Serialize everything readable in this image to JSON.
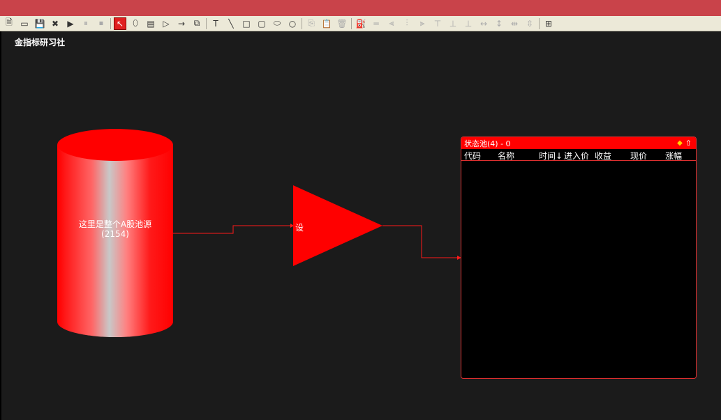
{
  "toolbar": {
    "buttons": [
      {
        "icon": "new-document-icon",
        "glyph": "🗎",
        "enabled": true
      },
      {
        "icon": "open-folder-icon",
        "glyph": "▭",
        "enabled": true
      },
      {
        "icon": "save-icon",
        "glyph": "💾",
        "enabled": true
      },
      {
        "icon": "close-x-icon",
        "glyph": "✖",
        "enabled": true
      },
      {
        "icon": "play-circle-icon",
        "glyph": "▶",
        "enabled": true
      },
      {
        "icon": "pause-circle-icon",
        "glyph": "⏸",
        "enabled": false
      },
      {
        "icon": "stop-circle-icon",
        "glyph": "⏹",
        "enabled": false
      },
      {
        "icon": "pointer-select-icon",
        "glyph": "↖",
        "enabled": true,
        "selected": true
      },
      {
        "icon": "cylinder-tool-icon",
        "glyph": "⬯",
        "enabled": true
      },
      {
        "icon": "list-box-tool-icon",
        "glyph": "▤",
        "enabled": true
      },
      {
        "icon": "triangle-tool-icon",
        "glyph": "▷",
        "enabled": true
      },
      {
        "icon": "arrow-tool-icon",
        "glyph": "→",
        "enabled": true
      },
      {
        "icon": "group-tool-icon",
        "glyph": "⧉",
        "enabled": true
      },
      {
        "icon": "text-tool-icon",
        "glyph": "T",
        "enabled": true
      },
      {
        "icon": "line-tool-icon",
        "glyph": "╲",
        "enabled": true
      },
      {
        "icon": "rectangle-tool-icon",
        "glyph": "□",
        "enabled": true
      },
      {
        "icon": "rounded-rect-tool-icon",
        "glyph": "▢",
        "enabled": true
      },
      {
        "icon": "ellipse-tool-icon",
        "glyph": "⬭",
        "enabled": true
      },
      {
        "icon": "circle-tool-icon",
        "glyph": "○",
        "enabled": true
      },
      {
        "icon": "copy-icon",
        "glyph": "⎘",
        "enabled": false
      },
      {
        "icon": "paste-icon",
        "glyph": "📋",
        "enabled": false
      },
      {
        "icon": "delete-icon",
        "glyph": "🗑",
        "enabled": false
      },
      {
        "icon": "fill-color-icon",
        "glyph": "⛽",
        "enabled": true
      },
      {
        "icon": "line-style-icon",
        "glyph": "═",
        "enabled": false
      },
      {
        "icon": "align-left-icon",
        "glyph": "⫷",
        "enabled": false
      },
      {
        "icon": "align-center-icon",
        "glyph": "⫶",
        "enabled": false
      },
      {
        "icon": "align-right-icon",
        "glyph": "⫸",
        "enabled": false
      },
      {
        "icon": "align-top-icon",
        "glyph": "⊤",
        "enabled": false
      },
      {
        "icon": "align-middle-icon",
        "glyph": "⊥",
        "enabled": false
      },
      {
        "icon": "align-bottom-icon",
        "glyph": "⊥",
        "enabled": false
      },
      {
        "icon": "same-width-icon",
        "glyph": "↔",
        "enabled": false
      },
      {
        "icon": "same-height-icon",
        "glyph": "↕",
        "enabled": false
      },
      {
        "icon": "space-horizontal-icon",
        "glyph": "⇹",
        "enabled": false
      },
      {
        "icon": "space-vertical-icon",
        "glyph": "⇳",
        "enabled": false
      },
      {
        "icon": "grid-icon",
        "glyph": "⊞",
        "enabled": true
      }
    ]
  },
  "brand": "金指标研习社",
  "cylinder": {
    "label": "这里是整个A股池源",
    "count": "(2154)"
  },
  "triangle": {
    "label": "设"
  },
  "pool": {
    "title": "状态池(4) - 0",
    "columns": [
      "代码",
      "名称",
      "时间↓",
      "进入价",
      "收益",
      "现价",
      "涨幅"
    ]
  },
  "colors": {
    "accent": "#ff0000",
    "titlebar": "#c9434a",
    "canvas": "#1b1b1b",
    "toolbar": "#ece9d8"
  }
}
